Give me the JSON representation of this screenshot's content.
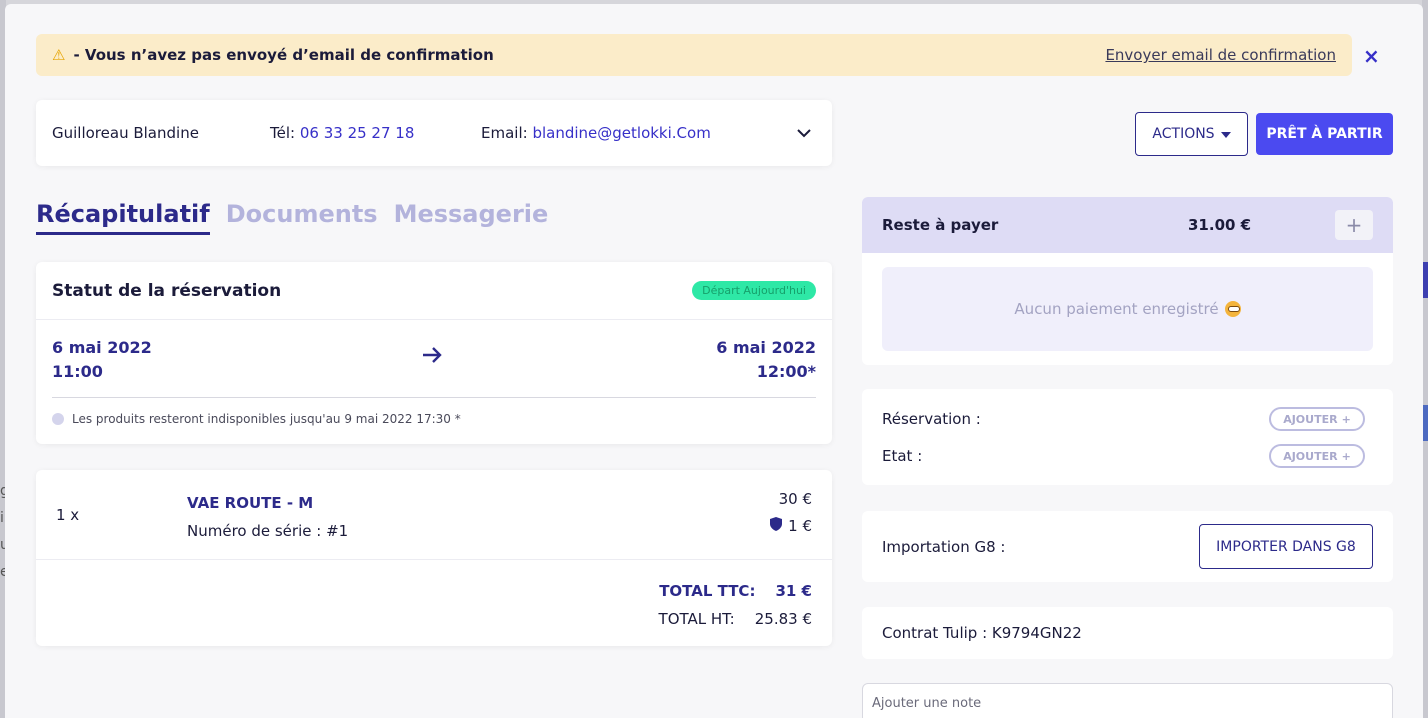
{
  "banner": {
    "icon": "warning-icon",
    "text": "- Vous n’avez pas envoyé d’email de confirmation",
    "link": "Envoyer email de confirmation",
    "close": "×"
  },
  "customer": {
    "name": "Guilloreau Blandine",
    "tel_label": "Tél:",
    "tel_value": "06 33 25 27 18",
    "email_label": "Email:",
    "email_value": "blandine@getlokki.Com"
  },
  "toolbar": {
    "actions_label": "ACTIONS",
    "ready_label": "PRÊT À PARTIR"
  },
  "tabs": [
    {
      "label": "Récapitulatif",
      "active": true
    },
    {
      "label": "Documents",
      "active": false
    },
    {
      "label": "Messagerie",
      "active": false
    }
  ],
  "status": {
    "title": "Statut de la réservation",
    "badge": "Départ Aujourd'hui",
    "start_date": "6 mai 2022",
    "start_time": "11:00",
    "end_date": "6 mai 2022",
    "end_time": "12:00*",
    "note": "Les produits resteront indisponibles jusqu'au 9 mai 2022 17:30 *"
  },
  "product": {
    "qty": "1 x",
    "name": "VAE ROUTE - M",
    "serial": "Numéro de série : #1",
    "price": "30 €",
    "insurance": "1 €"
  },
  "totals": {
    "ttc_label": "TOTAL TTC:",
    "ttc_value": "31 €",
    "ht_label": "TOTAL HT:",
    "ht_value": "25.83 €"
  },
  "payment": {
    "label": "Reste à payer",
    "amount": "31.00 €",
    "empty": "Aucun paiement enregistré"
  },
  "reservation": {
    "resa_label": "Réservation :",
    "etat_label": "Etat :",
    "add_label": "AJOUTER"
  },
  "g8": {
    "label": "Importation G8 :",
    "button": "IMPORTER DANS G8"
  },
  "tulip": {
    "text": "Contrat Tulip : K9794GN22"
  },
  "note": {
    "placeholder": "Ajouter une note"
  },
  "colors": {
    "accent": "#4b4af0",
    "primary": "#2c2a8a",
    "warning_bg": "#fbecc9",
    "badge_bg": "#2ee8a6"
  }
}
